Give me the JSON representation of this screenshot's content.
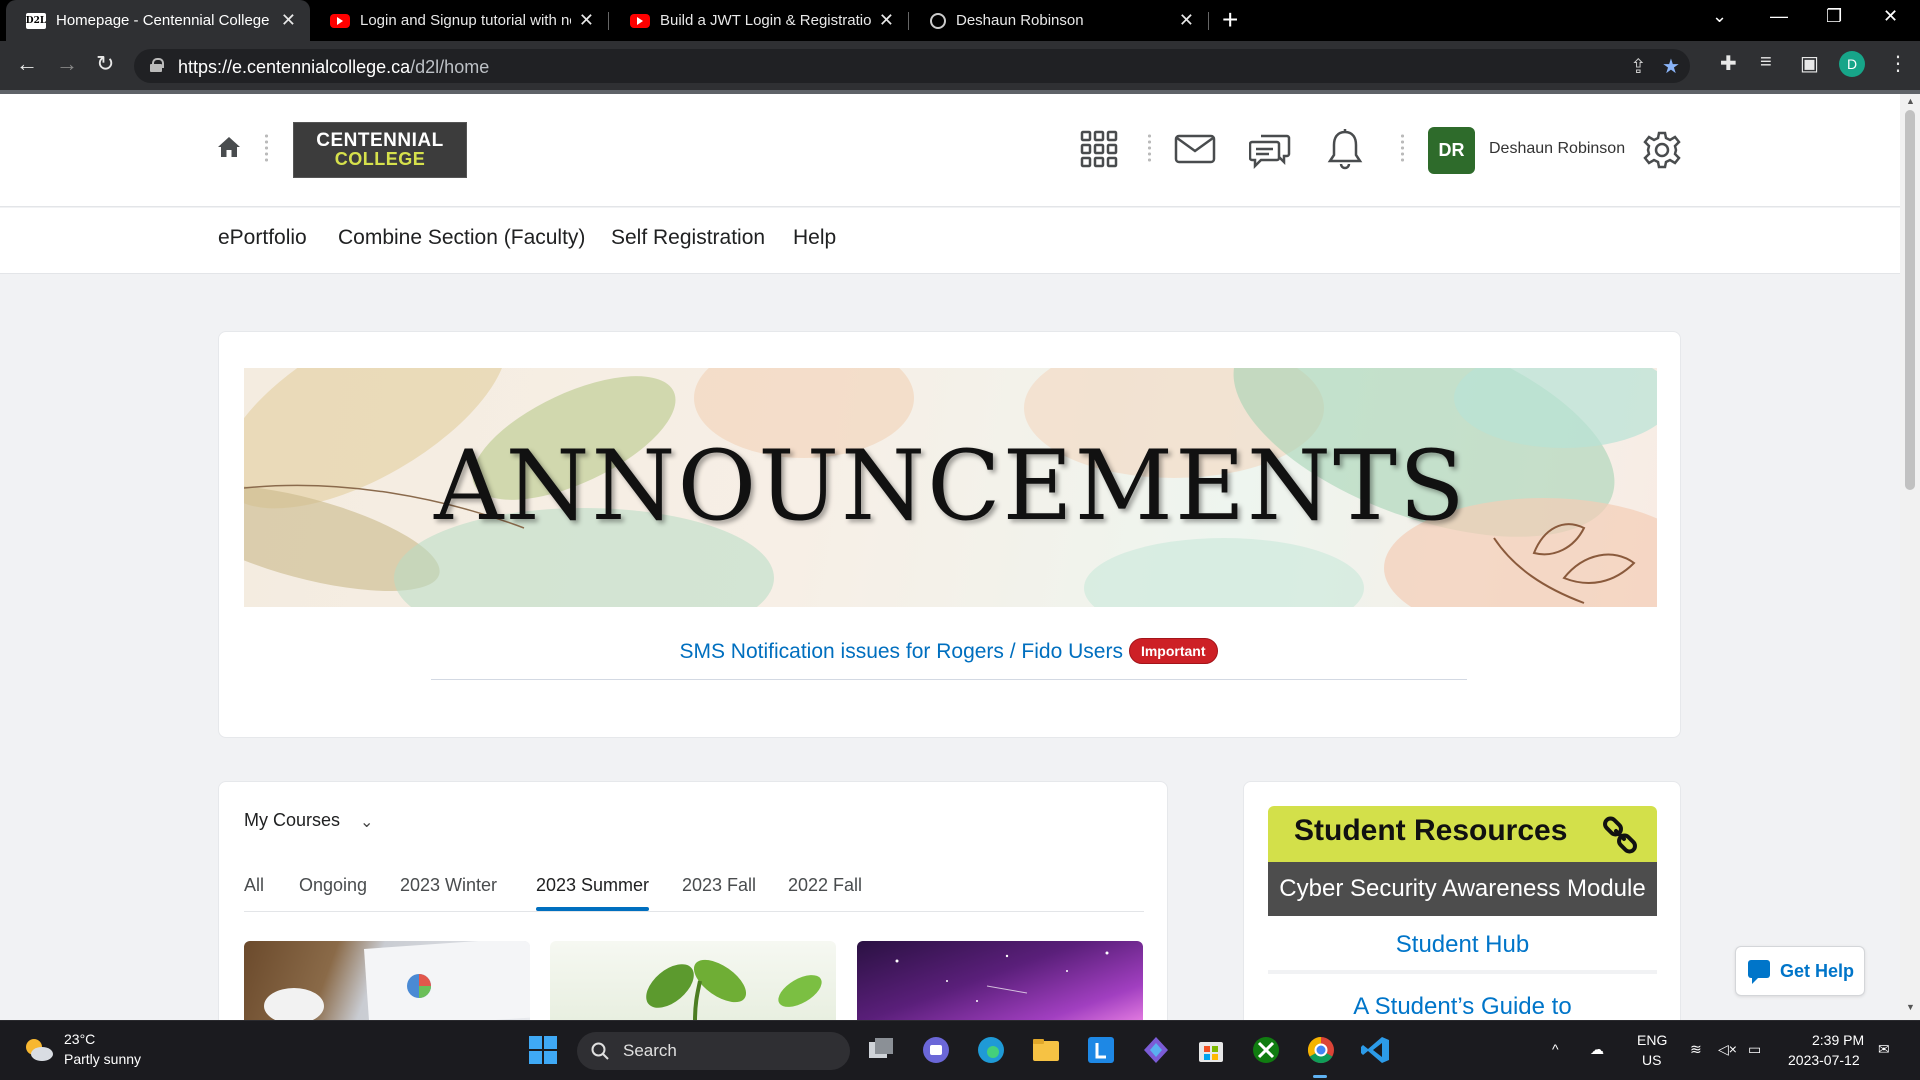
{
  "browser": {
    "tabs": [
      {
        "title": "Homepage - Centennial College",
        "icon": "d2l-favicon",
        "favicon_text": "D2L"
      },
      {
        "title": "Login and Signup tutorial with nc",
        "icon": "youtube-favicon"
      },
      {
        "title": "Build a JWT Login & Registration",
        "icon": "youtube-favicon"
      },
      {
        "title": "Deshaun Robinson",
        "icon": "globe-favicon"
      }
    ],
    "new_tab": "+",
    "close": "✕",
    "url_host": "https://e.centennialcollege.ca",
    "url_path": "/d2l/home",
    "profile_initial": "D"
  },
  "header": {
    "logo_line1": "CENTENNIAL",
    "logo_line2": "COLLEGE",
    "user_initials": "DR",
    "user_name": "Deshaun Robinson"
  },
  "nav": [
    "ePortfolio",
    "Combine Section (Faculty)",
    "Self Registration",
    "Help"
  ],
  "announcements": {
    "banner_text": "ANNOUNCEMENTS",
    "link_text": "SMS Notification issues for Rogers / Fido Users",
    "badge": "Important"
  },
  "my_courses": {
    "title": "My Courses",
    "tabs": [
      "All",
      "Ongoing",
      "2023 Winter",
      "2023 Summer",
      "2023 Fall",
      "2022 Fall"
    ],
    "selected_tab": "2023 Summer"
  },
  "student_resources": {
    "title": "Student Resources",
    "items": [
      "Cyber Security Awareness Module",
      "Student Hub",
      "A Student’s Guide to"
    ]
  },
  "get_help": "Get Help",
  "taskbar": {
    "temp": "23°C",
    "weather": "Partly sunny",
    "search": "Search",
    "lang1": "ENG",
    "lang2": "US",
    "time": "2:39 PM",
    "date": "2023-07-12"
  },
  "colors": {
    "accent": "#006fbf",
    "avatar": "#2e6b2b",
    "resources_header": "#d3e04a",
    "badge": "#cd2026"
  }
}
